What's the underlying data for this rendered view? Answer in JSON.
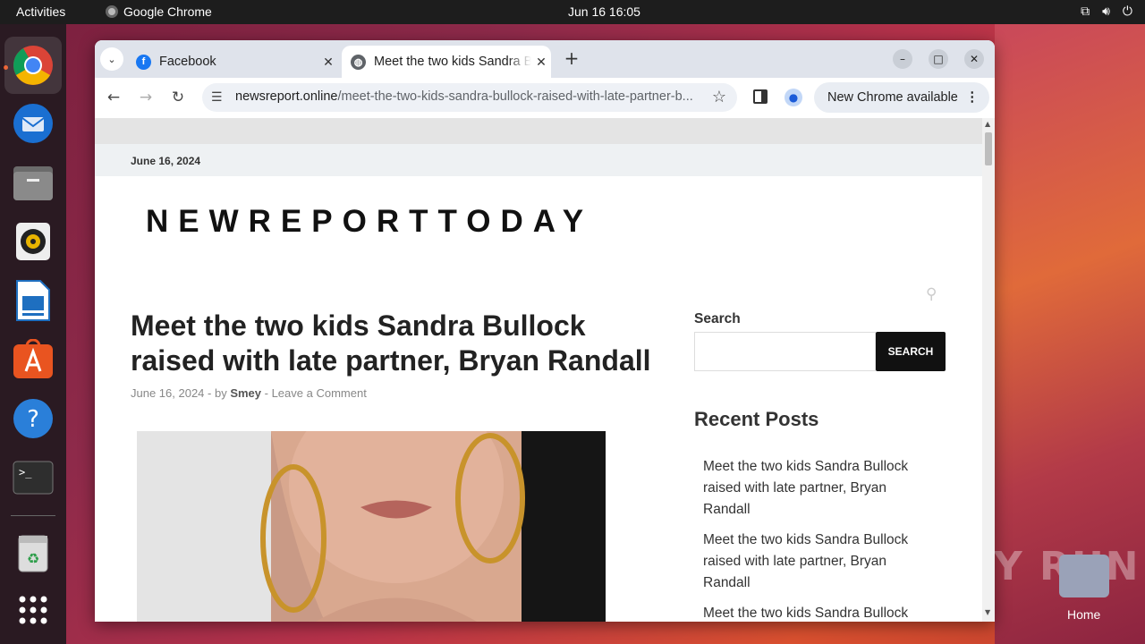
{
  "topbar": {
    "activities": "Activities",
    "app_name": "Google Chrome",
    "clock": "Jun 16  16:05"
  },
  "dock": {
    "items": [
      "chrome-icon",
      "thunderbird-icon",
      "files-icon",
      "rhythmbox-icon",
      "libreoffice-writer-icon",
      "app-center-icon",
      "help-icon",
      "terminal-icon",
      "trash-icon",
      "app-grid-icon"
    ]
  },
  "browser": {
    "tabs": [
      {
        "title": "Facebook",
        "favicon": "facebook-icon"
      },
      {
        "title": "Meet the two kids Sandra Bullock raised with late partner, Bryan Randall",
        "favicon": "globe-icon"
      }
    ],
    "new_tab": "+",
    "url_host": "newsreport.online",
    "url_path": "/meet-the-two-kids-sandra-bullock-raised-with-late-partner-b...",
    "update_chip": "New Chrome available"
  },
  "page": {
    "date_bar": "June 16, 2024",
    "site_title": "NEWREPORTTODAY",
    "post_title": "Meet the two kids Sandra Bullock raised with late partner, Bryan Randall",
    "meta": {
      "date": "June 16, 2024",
      "sep1": " - by ",
      "author": "Smey",
      "sep2": " - ",
      "comment": "Leave a Comment"
    },
    "sidebar": {
      "search_heading": "Search",
      "search_button": "SEARCH",
      "recent_heading": "Recent Posts",
      "recent_posts": [
        "Meet the two kids Sandra Bullock raised with late partner, Bryan Randall",
        "Meet the two kids Sandra Bullock raised with late partner, Bryan Randall",
        "Meet the two kids Sandra Bullock"
      ]
    }
  },
  "desktop": {
    "watermark": "ANY RUN",
    "home_label": "Home"
  }
}
